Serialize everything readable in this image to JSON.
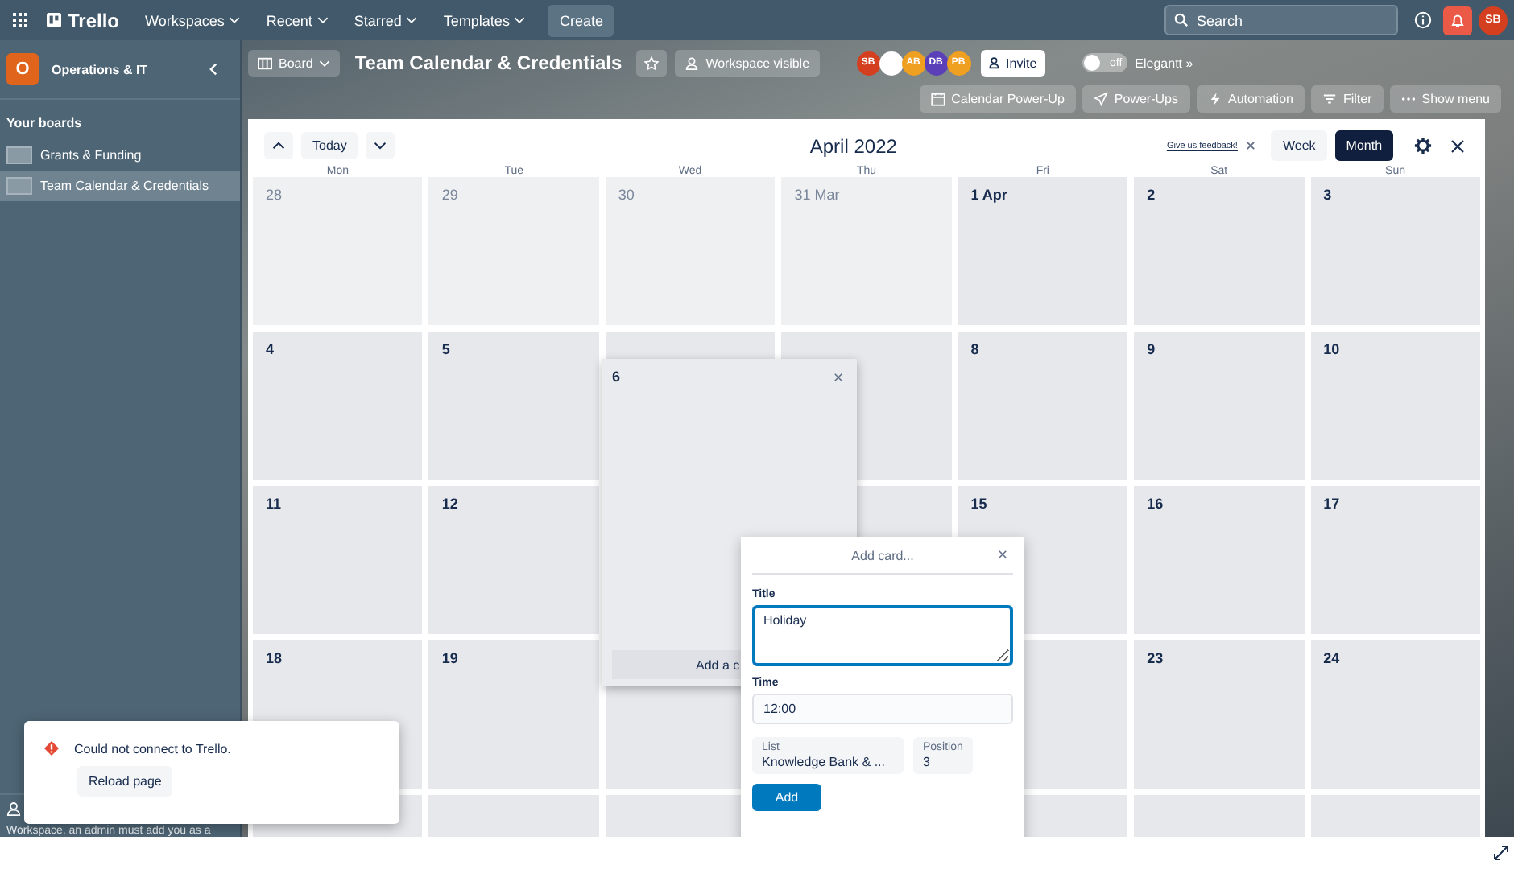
{
  "top_nav": {
    "logo": "Trello",
    "menus": [
      {
        "label": "Workspaces"
      },
      {
        "label": "Recent"
      },
      {
        "label": "Starred"
      },
      {
        "label": "Templates"
      }
    ],
    "create": "Create",
    "search": {
      "placeholder": "Search"
    },
    "avatar": "SB"
  },
  "sidebar": {
    "workspace_badge": "O",
    "workspace_name": "Operations & IT",
    "section_title": "Your boards",
    "boards": [
      {
        "label": "Grants & Funding",
        "selected": false
      },
      {
        "label": "Team Calendar & Credentials",
        "selected": true
      }
    ],
    "footer_text": "Workspace, an admin must add you as a"
  },
  "board_header": {
    "view_button": "Board",
    "title": "Team Calendar & Credentials",
    "visibility": "Workspace visible",
    "members": [
      {
        "kind": "initials",
        "initials": "SB",
        "color": "#d4401f"
      },
      {
        "kind": "picture"
      },
      {
        "kind": "initials",
        "initials": "AB",
        "color": "#f0a020"
      },
      {
        "kind": "initials",
        "initials": "DB",
        "color": "#5b3fb8"
      },
      {
        "kind": "initials",
        "initials": "PB",
        "color": "#f0a020"
      }
    ],
    "invite": "Invite",
    "toggle": {
      "on": false,
      "state_label": "off",
      "label": "Elegantt »"
    },
    "actions": [
      {
        "kind": "calendar",
        "label": "Calendar Power-Up"
      },
      {
        "kind": "powerups",
        "label": "Power-Ups"
      },
      {
        "kind": "automation",
        "label": "Automation"
      },
      {
        "kind": "filter",
        "label": "Filter"
      },
      {
        "kind": "menu",
        "label": "Show menu"
      }
    ]
  },
  "calendar": {
    "today": "Today",
    "title": "April 2022",
    "feedback_link": "Give us feedback!",
    "views": [
      {
        "label": "Week",
        "selected": false
      },
      {
        "label": "Month",
        "selected": true
      }
    ],
    "weekdays": [
      "Mon",
      "Tue",
      "Wed",
      "Thu",
      "Fri",
      "Sat",
      "Sun"
    ],
    "weeks": [
      [
        {
          "kind": "day",
          "day": "28",
          "current_month": false
        },
        {
          "kind": "day",
          "day": "29",
          "current_month": false
        },
        {
          "kind": "day",
          "day": "30",
          "current_month": false
        },
        {
          "kind": "day",
          "day": "31 Mar",
          "current_month": false
        },
        {
          "kind": "day",
          "day": "1 Apr",
          "current_month": true
        },
        {
          "kind": "day",
          "day": "2",
          "current_month": true
        },
        {
          "kind": "day",
          "day": "3",
          "current_month": true
        }
      ],
      [
        {
          "kind": "day",
          "day": "4",
          "current_month": true
        },
        {
          "kind": "day",
          "day": "5",
          "current_month": true
        },
        {
          "kind": "blank"
        },
        {
          "kind": "blank"
        },
        {
          "kind": "day",
          "day": "8",
          "current_month": true
        },
        {
          "kind": "day",
          "day": "9",
          "current_month": true
        },
        {
          "kind": "day",
          "day": "10",
          "current_month": true
        }
      ],
      [
        {
          "kind": "day",
          "day": "11",
          "current_month": true
        },
        {
          "kind": "day",
          "day": "12",
          "current_month": true
        },
        {
          "kind": "blank"
        },
        {
          "kind": "blank"
        },
        {
          "kind": "day",
          "day": "15",
          "current_month": true
        },
        {
          "kind": "day",
          "day": "16",
          "current_month": true
        },
        {
          "kind": "day",
          "day": "17",
          "current_month": true
        }
      ],
      [
        {
          "kind": "day",
          "day": "18",
          "current_month": true
        },
        {
          "kind": "day",
          "day": "19",
          "current_month": true
        },
        {
          "kind": "blank"
        },
        {
          "kind": "blank"
        },
        {
          "kind": "blank"
        },
        {
          "kind": "day",
          "day": "23",
          "current_month": true
        },
        {
          "kind": "day",
          "day": "24",
          "current_month": true
        }
      ],
      [
        {
          "kind": "blank"
        },
        {
          "kind": "blank"
        },
        {
          "kind": "blank"
        },
        {
          "kind": "blank"
        },
        {
          "kind": "blank"
        },
        {
          "kind": "blank"
        },
        {
          "kind": "blank"
        }
      ]
    ],
    "expanded_day": {
      "day": "6",
      "add_button": "Add a c"
    },
    "add_card": {
      "heading": "Add card...",
      "title_label": "Title",
      "title_value": "Holiday",
      "time_label": "Time",
      "time_value": "12:00",
      "list_label": "List",
      "list_value": "Knowledge Bank & ...",
      "position_label": "Position",
      "position_value": "3",
      "submit": "Add"
    }
  },
  "toast": {
    "message": "Could not connect to Trello.",
    "action": "Reload page"
  }
}
